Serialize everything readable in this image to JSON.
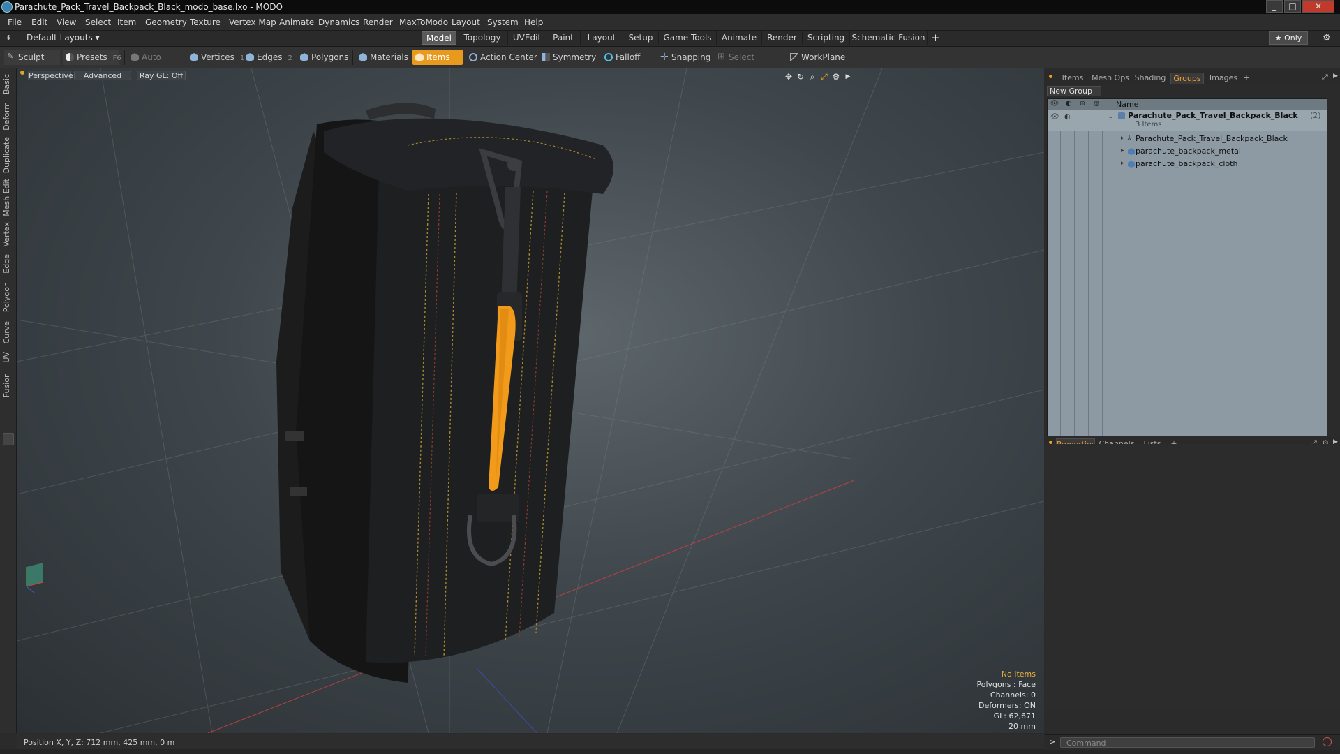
{
  "window": {
    "title": "Parachute_Pack_Travel_Backpack_Black_modo_base.lxo - MODO",
    "controls": [
      "_",
      "□",
      "✕"
    ]
  },
  "menu": [
    "File",
    "Edit",
    "View",
    "Select",
    "Item",
    "Geometry",
    "Texture",
    "Vertex Map",
    "Animate",
    "Dynamics",
    "Render",
    "MaxToModo",
    "Layout",
    "System",
    "Help"
  ],
  "layoutbar": {
    "layouts_label": "Default Layouts ▾",
    "tabs": [
      "Model",
      "Topology",
      "UVEdit",
      "Paint",
      "Layout",
      "Setup",
      "Game Tools",
      "Animate",
      "Render",
      "Scripting",
      "Schematic Fusion"
    ],
    "active_tab": "Model",
    "add": "+",
    "only_label": "★ Only"
  },
  "toolbar": {
    "sculpt": "Sculpt",
    "presets": "Presets",
    "presets_key": "F6",
    "auto_select": "Auto Select",
    "vertices": "Vertices",
    "vertices_key": "1",
    "edges": "Edges",
    "edges_key": "2",
    "polygons": "Polygons",
    "materials": "Materials",
    "items": "Items",
    "action_center": "Action Center",
    "symmetry": "Symmetry",
    "falloff": "Falloff",
    "snapping": "Snapping",
    "select_through": "Select Through",
    "workplane": "WorkPlane"
  },
  "left_tabs": [
    "Basic",
    "Deform",
    "Duplicate",
    "Mesh Edit",
    "Vertex",
    "Edge",
    "Polygon",
    "Curve",
    "UV",
    "Fusion"
  ],
  "viewport": {
    "perspective": "Perspective",
    "advanced": "Advanced",
    "raygl": "Ray GL: Off",
    "stats": {
      "no_items": "No Items",
      "polygons": "Polygons : Face",
      "channels": "Channels: 0",
      "deformers": "Deformers: ON",
      "gl": "GL: 62,671",
      "size": "20 mm"
    }
  },
  "statusbar": {
    "position": "Position X, Y, Z:  712 mm, 425 mm, 0 m"
  },
  "right_panel": {
    "top_tabs": [
      "Items",
      "Mesh Ops",
      "Shading",
      "Groups",
      "Images",
      "+"
    ],
    "active_top_tab": "Groups",
    "new_group": "New Group",
    "tree_header_name": "Name",
    "group_name": "Parachute_Pack_Travel_Backpack_Black",
    "group_count": "(2)",
    "group_sub": "3 Items",
    "children": [
      "Parachute_Pack_Travel_Backpack_Black",
      "parachute_backpack_metal",
      "parachute_backpack_cloth"
    ],
    "bottom_tabs": [
      "Properties",
      "Channels",
      "Lists",
      "+"
    ],
    "active_bottom_tab": "Properties",
    "command_placeholder": "Command",
    "prompt": ">"
  },
  "colors": {
    "accent": "#e89a1e",
    "active_tab_text": "#f0a030",
    "tree_bg": "#8d9aa3",
    "strap": "#f29a1a"
  }
}
